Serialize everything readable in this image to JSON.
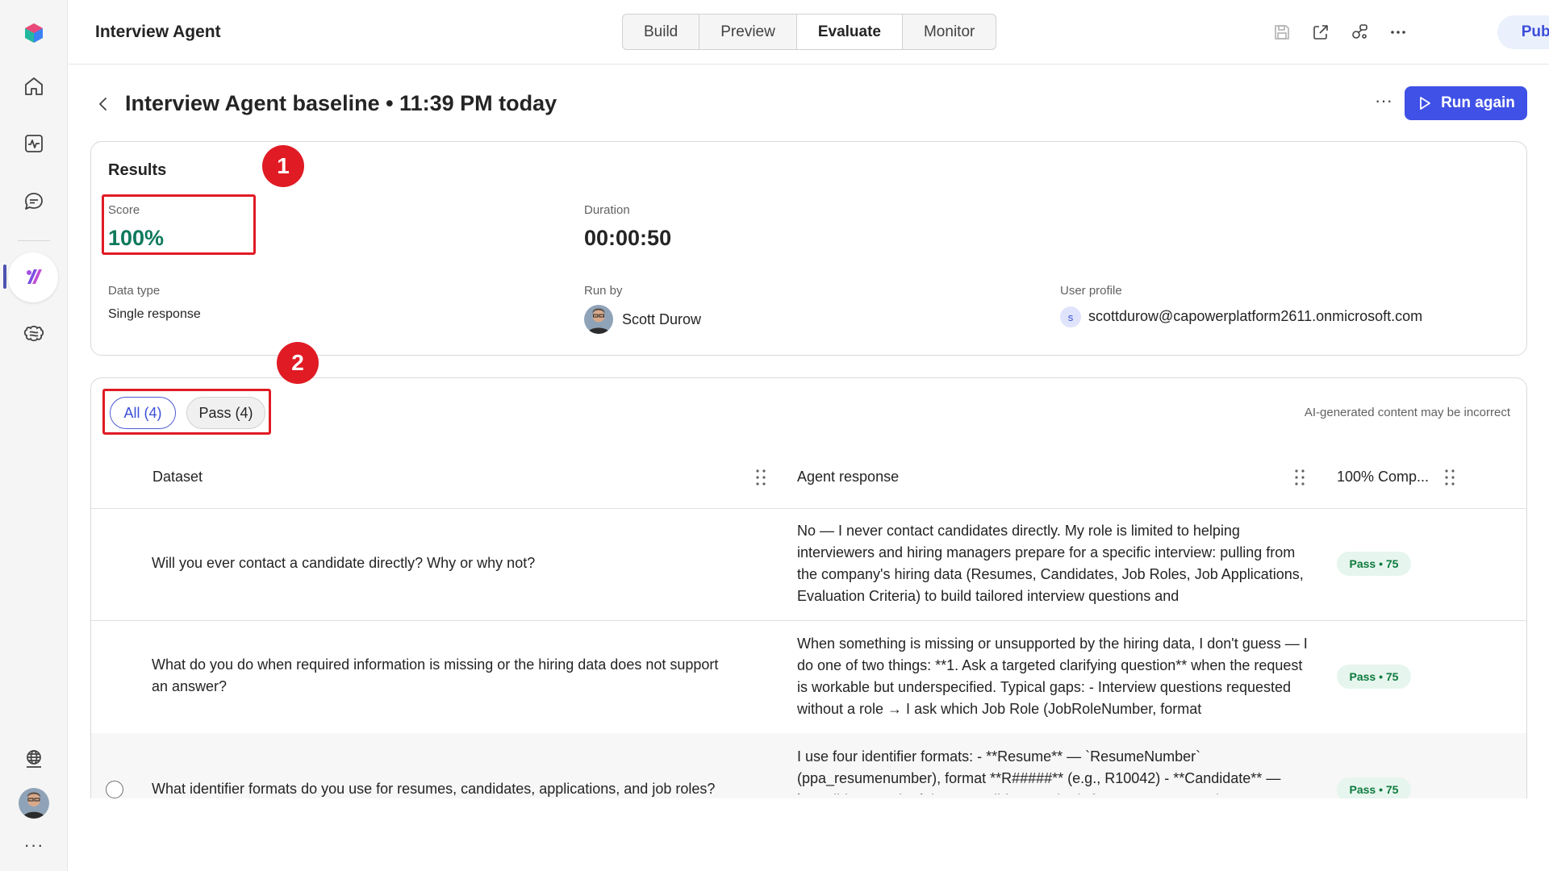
{
  "header": {
    "agent_name": "Interview Agent",
    "tabs": [
      {
        "label": "Build",
        "active": false
      },
      {
        "label": "Preview",
        "active": false
      },
      {
        "label": "Evaluate",
        "active": true
      },
      {
        "label": "Monitor",
        "active": false
      }
    ],
    "icons": [
      "save-icon",
      "share-icon",
      "connect-icon",
      "more-icon"
    ],
    "publish_label": "Publish"
  },
  "rail": {
    "items": [
      "app-logo-icon",
      "home-icon",
      "activity-icon",
      "chat-icon",
      "agent-icon",
      "knowledge-icon",
      "globe-icon"
    ],
    "more": "···"
  },
  "page": {
    "title": "Interview Agent baseline • 11:39 PM today",
    "more": "···",
    "run_again_label": "Run again"
  },
  "results": {
    "title": "Results",
    "score_label": "Score",
    "score_value": "100%",
    "duration_label": "Duration",
    "duration_value": "00:00:50",
    "data_type_label": "Data type",
    "data_type_value": "Single response",
    "run_by_label": "Run by",
    "run_by_value": "Scott Durow",
    "user_profile_label": "User profile",
    "user_profile_initial": "s",
    "user_profile_value": "scottdurow@capowerplatform2611.onmicrosoft.com"
  },
  "markers": {
    "one": "1",
    "two": "2"
  },
  "filters": {
    "all": "All (4)",
    "pass": "Pass (4)"
  },
  "ai_note": "AI-generated content may be incorrect",
  "table": {
    "headers": {
      "dataset": "Dataset",
      "agent_response": "Agent response",
      "comp": "100% Comp..."
    },
    "rows": [
      {
        "question": "Will you ever contact a candidate directly? Why or why not?",
        "response": "No — I never contact candidates directly. My role is limited to helping interviewers and hiring managers prepare for a specific interview: pulling from the company's hiring data (Resumes, Candidates, Job Roles, Job Applications, Evaluation Criteria) to build tailored interview questions and",
        "result": "Pass • 75"
      },
      {
        "question": "What do you do when required information is missing or the hiring data does not support an answer?",
        "response": "When something is missing or unsupported by the hiring data, I don't guess — I do one of two things: **1. Ask a targeted clarifying question** when the request is workable but underspecified. Typical gaps: - Interview questions requested without a role → I ask which Job Role (JobRoleNumber, format",
        "result": "Pass • 75"
      },
      {
        "question": "What identifier formats do you use for resumes, candidates, applications, and job roles?",
        "response": "I use four identifier formats: - **Resume** — `ResumeNumber` (ppa_resumenumber), format **R#####** (e.g., R10042) - **Candidate** — `CandidateNumber` (ppa_candidatenumber), format **C#####** (e.g.",
        "result": "Pass • 75"
      }
    ]
  },
  "colors": {
    "accent": "#3f51e6",
    "score_green": "#0e7a5c",
    "marker_red": "#e01b24",
    "pass_bg": "#e6f6ee"
  }
}
